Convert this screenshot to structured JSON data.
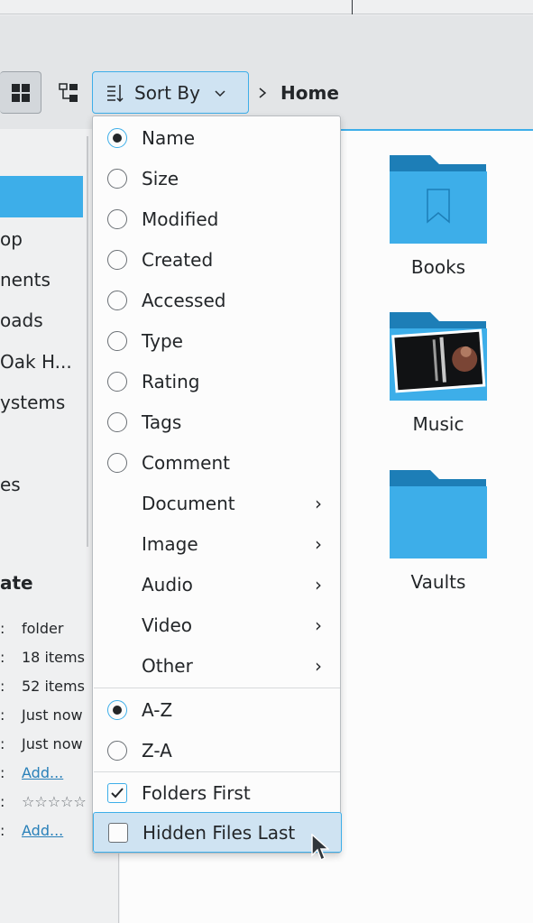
{
  "toolbar": {
    "sort_by_label": "Sort By",
    "breadcrumb": {
      "current": "Home"
    },
    "icons": [
      "icons-view-icon",
      "tree-view-icon",
      "sort-icon",
      "chevron-down-icon",
      "chevron-right-icon"
    ]
  },
  "sidebar": {
    "items": [
      "op",
      "nents",
      "oads",
      "Oak H...",
      "ystems",
      "es"
    ],
    "info_heading": "ate",
    "info_rows": [
      {
        "value": "folder"
      },
      {
        "value": "18 items"
      },
      {
        "value": "52 items"
      },
      {
        "value": "Just now"
      },
      {
        "value": "Just now"
      },
      {
        "value": "Add...",
        "link": true
      },
      {
        "value": "☆☆☆☆☆",
        "rating": 0
      },
      {
        "value": "Add...",
        "link": true
      }
    ]
  },
  "content": {
    "tiles": [
      {
        "label": "Books",
        "icon": "books-folder-icon"
      },
      {
        "label": "Music",
        "icon": "music-folder-icon"
      },
      {
        "label": "Vaults",
        "icon": "vaults-folder-icon"
      }
    ]
  },
  "sort_menu": {
    "sort_fields": [
      {
        "label": "Name",
        "selected": true
      },
      {
        "label": "Size",
        "selected": false
      },
      {
        "label": "Modified",
        "selected": false
      },
      {
        "label": "Created",
        "selected": false
      },
      {
        "label": "Accessed",
        "selected": false
      },
      {
        "label": "Type",
        "selected": false
      },
      {
        "label": "Rating",
        "selected": false
      },
      {
        "label": "Tags",
        "selected": false
      },
      {
        "label": "Comment",
        "selected": false
      }
    ],
    "submenus": [
      {
        "label": "Document"
      },
      {
        "label": "Image"
      },
      {
        "label": "Audio"
      },
      {
        "label": "Video"
      },
      {
        "label": "Other"
      }
    ],
    "order": [
      {
        "label": "A-Z",
        "selected": true
      },
      {
        "label": "Z-A",
        "selected": false
      }
    ],
    "options": [
      {
        "label": "Folders First",
        "checked": true
      },
      {
        "label": "Hidden Files Last",
        "checked": false,
        "hovered": true
      }
    ]
  },
  "colors": {
    "accent": "#3daee9",
    "folder": "#3daee9",
    "selection_bg": "#cfe3f2",
    "link": "#2980b9"
  }
}
